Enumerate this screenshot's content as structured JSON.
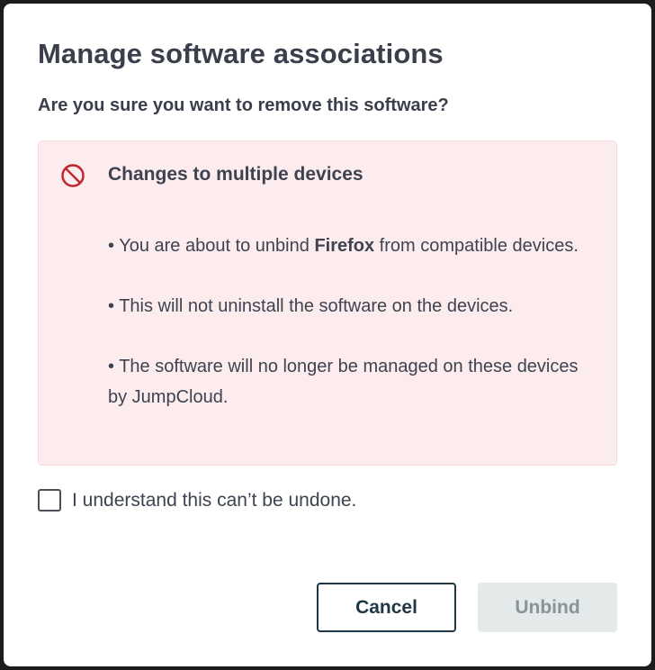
{
  "dialog": {
    "title": "Manage software associations",
    "subtitle": "Are you sure you want to remove this software?"
  },
  "alert": {
    "icon": "prohibited-icon",
    "title": "Changes to multiple devices",
    "items": [
      {
        "prefix": "• You are about to unbind ",
        "bold": "Firefox",
        "suffix": " from compatible devices."
      },
      {
        "text": "• This will not uninstall the software on the devices."
      },
      {
        "text": "• The software will no longer be managed on these devices by JumpCloud."
      }
    ]
  },
  "confirm": {
    "checked": false,
    "label": "I understand this can’t be undone."
  },
  "actions": {
    "cancel_label": "Cancel",
    "unbind_label": "Unbind"
  },
  "colors": {
    "alert_background": "#fdecee",
    "alert_icon": "#c0262d",
    "cancel_border": "#1f3644",
    "unbind_disabled_background": "#e4e9ea"
  }
}
